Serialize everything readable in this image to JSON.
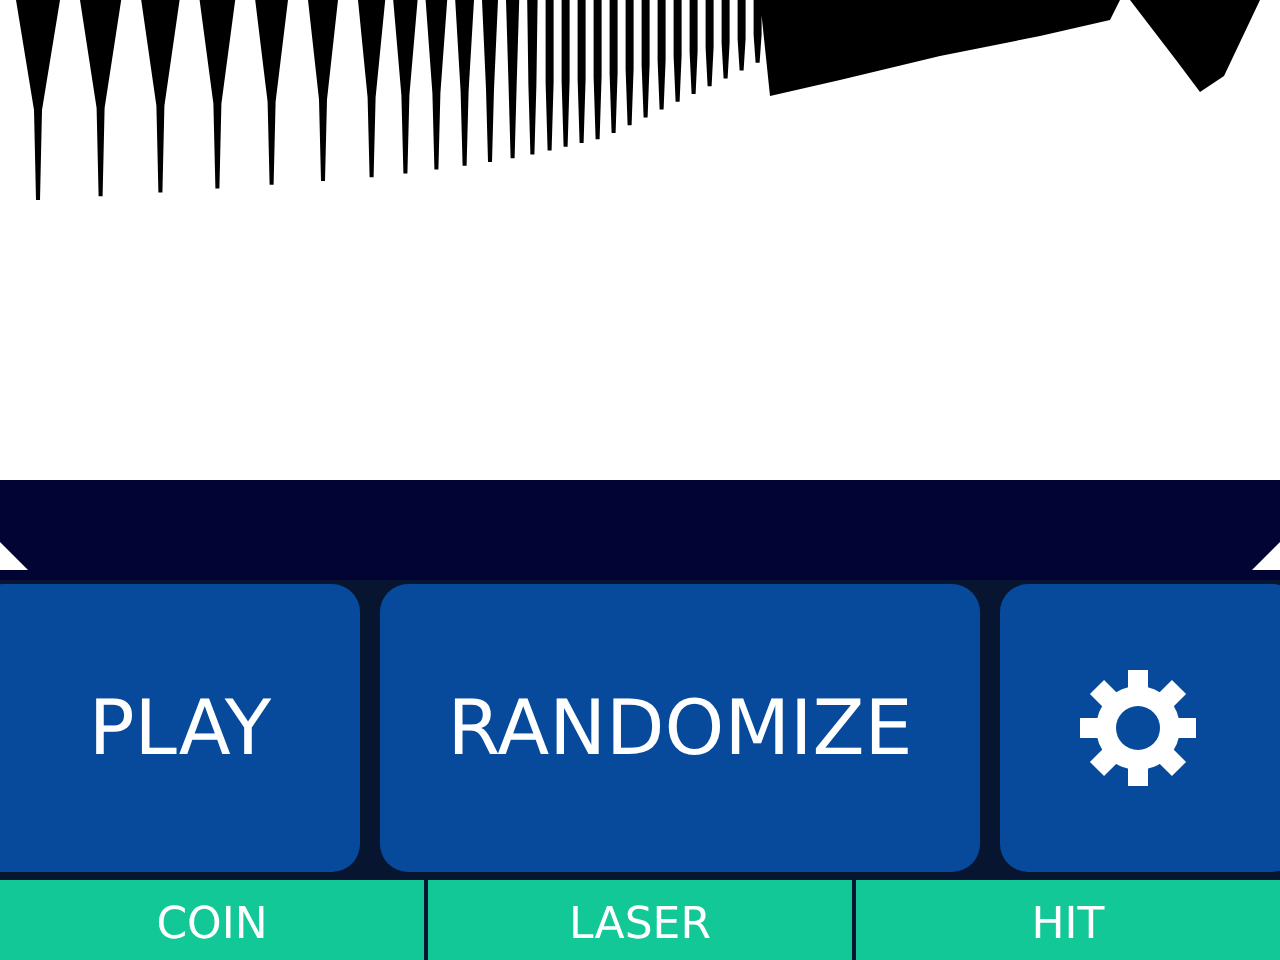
{
  "actions": [
    {
      "kind": "text",
      "label": "PLAY"
    },
    {
      "kind": "text",
      "label": "RANDOMIZE"
    },
    {
      "kind": "settings"
    }
  ],
  "presets": [
    {
      "label": "COIN"
    },
    {
      "label": "LASER"
    },
    {
      "label": "HIT"
    }
  ]
}
